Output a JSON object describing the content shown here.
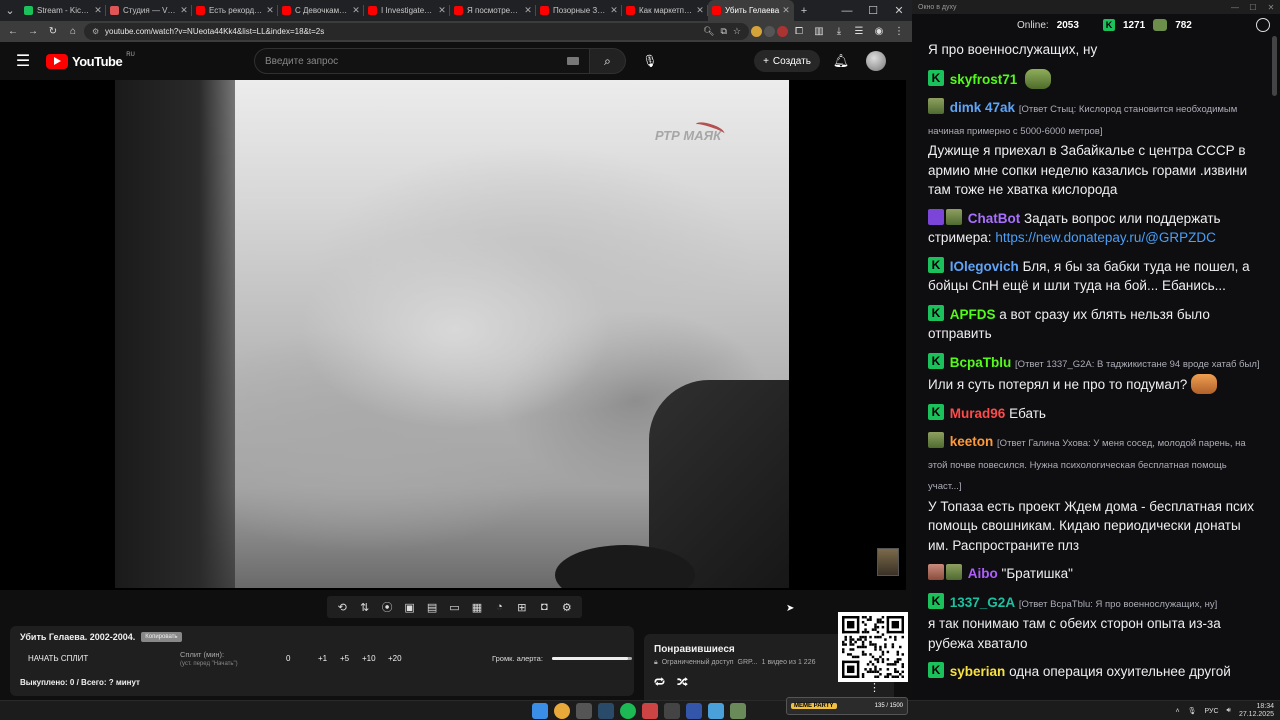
{
  "browser": {
    "tabs": [
      {
        "title": "Stream - Kick Dash",
        "color": "#1bc15a",
        "active": false
      },
      {
        "title": "Студия — VK Видео",
        "color": "#e05555",
        "active": false
      },
      {
        "title": "Есть рекорд! Пере",
        "color": "#ff0000",
        "active": false
      },
      {
        "title": "С Девочками Боле",
        "color": "#ff0000",
        "active": false
      },
      {
        "title": "I Investigated Minn",
        "color": "#ff0000",
        "active": false
      },
      {
        "title": "Я посмотрел все д",
        "color": "#ff0000",
        "active": false
      },
      {
        "title": "Позорные Зоозащ",
        "color": "#ff0000",
        "active": false
      },
      {
        "title": "Как маркетплейсы",
        "color": "#ff0000",
        "active": false
      },
      {
        "title": "Убить Гелаева",
        "color": "#ff0000",
        "active": true
      }
    ],
    "new_tab": "+",
    "url": "youtube.com/watch?v=NUeota44Kk4&list=LL&index=18&t=2s"
  },
  "youtube": {
    "logo_text": "YouTube",
    "region": "RU",
    "search_placeholder": "Введите запрос",
    "create_label": "Создать",
    "video": {
      "watermark": "РТР МАЯК"
    },
    "toolbar_icons": [
      "repeat-icon",
      "sort-icon",
      "broadcast-icon",
      "screen-icon",
      "clip-icon",
      "aspect-icon",
      "subtitles-icon",
      "speed-icon",
      "add-frame-icon",
      "screenshot-icon",
      "settings-icon"
    ],
    "info": {
      "title": "Убить Гелаева. 2002-2004.",
      "copy_label": "Копировать",
      "start_split": "НАЧАТЬ СПЛИТ",
      "split_label": "Сплит (мин):",
      "split_hint": "(уст. перед \"Начать\")",
      "split_value": "0",
      "increments": [
        "+1",
        "+5",
        "+10",
        "+20"
      ],
      "volume_label": "Громк. алерта:",
      "volume_level": 0.95,
      "bought": "Выкуплено: 0 / Всего: ? минут"
    },
    "playlist": {
      "title": "Понравившиеся",
      "access": "Ограниченный доступ",
      "owner": "GRP...",
      "position": "1 видео из 1 226"
    }
  },
  "chat": {
    "window_title": "Окно в духу",
    "online_label": "Online:",
    "online_count": "2053",
    "kick_count": "1271",
    "frog_count": "782",
    "messages": [
      {
        "user": "",
        "color": "#efeff1",
        "reply": "",
        "text": "Я про военнослужащих, ну",
        "badges": [],
        "emote": ""
      },
      {
        "user": "skyfrost71",
        "color": "#53fc18",
        "reply": "",
        "text": "",
        "badges": [
          "k"
        ],
        "emote": "frog"
      },
      {
        "user": "dimk 47ak",
        "color": "#5fa4f7",
        "reply": "[Ответ Стыц: Кислород становится необходимым начиная примерно с 5000-6000 метров]",
        "text": "Дужище я приехал в Забайкалье с центра СССР в армию мне сопки неделю казались горами .извини там тоже не хватка кислорода",
        "badges": [
          "pepe"
        ],
        "emote": ""
      },
      {
        "user": "ChatBot",
        "color": "#a970ff",
        "reply": "",
        "text": "Задать вопрос или поддержать стримера:",
        "link": "https://new.donatepay.ru/@GRPZDC",
        "badges": [
          "bot",
          "pepe"
        ],
        "emote": ""
      },
      {
        "user": "IOlegovich",
        "color": "#5fa4f7",
        "reply": "",
        "text": "Бля, я бы за бабки туда не пошел, а бойцы СпН ещё и шли туда на бой... Ебанись...",
        "badges": [
          "k"
        ],
        "emote": ""
      },
      {
        "user": "APFDS",
        "color": "#53fc18",
        "reply": "",
        "text": "а вот сразу их блять нельзя было отправить",
        "badges": [
          "k"
        ],
        "emote": ""
      },
      {
        "user": "BcpaTblu",
        "color": "#53fc18",
        "reply": "[Ответ 1337_G2A: В таджикистане 94 вроде хатаб был]",
        "text": "Или я суть потерял и не про то подумал?",
        "badges": [
          "k"
        ],
        "emote": "fox"
      },
      {
        "user": "Murad96",
        "color": "#ff4a4a",
        "reply": "",
        "text": "Ебать",
        "badges": [
          "k"
        ],
        "emote": ""
      },
      {
        "user": "keeton",
        "color": "#ff9a3c",
        "reply": "[Ответ Галина Ухова: У меня сосед, молодой парень, на этой почве повесился. Нужна психологическая бесплатная помощь участ...]",
        "text": "У Топаза есть проект Ждем дома - бесплатная псих помощь свошникам. Кидаю периодически донаты им. Распространите плз",
        "badges": [
          "pepe"
        ],
        "emote": ""
      },
      {
        "user": "Aibo",
        "color": "#b05cff",
        "reply": "",
        "text": "\"Братишка\"",
        "badges": [
          "gift",
          "pepe"
        ],
        "emote": ""
      },
      {
        "user": "1337_G2A",
        "color": "#1bc1a0",
        "reply": "[Ответ BcpaTblu: Я про военнослужащих, ну]",
        "text": "я так понимаю там с обеих сторон опыта из-за рубежа хватало",
        "badges": [
          "k"
        ],
        "emote": ""
      },
      {
        "user": "syberian",
        "color": "#f8e142",
        "reply": "",
        "text": "одна операция охуительнее другой",
        "badges": [
          "k"
        ],
        "emote": ""
      }
    ]
  },
  "taskbar": {
    "meme_label": "MEME PARTY",
    "meme_progress": "135 / 1500",
    "lang": "РУС",
    "time": "18:34",
    "date": "27.12.2025"
  }
}
